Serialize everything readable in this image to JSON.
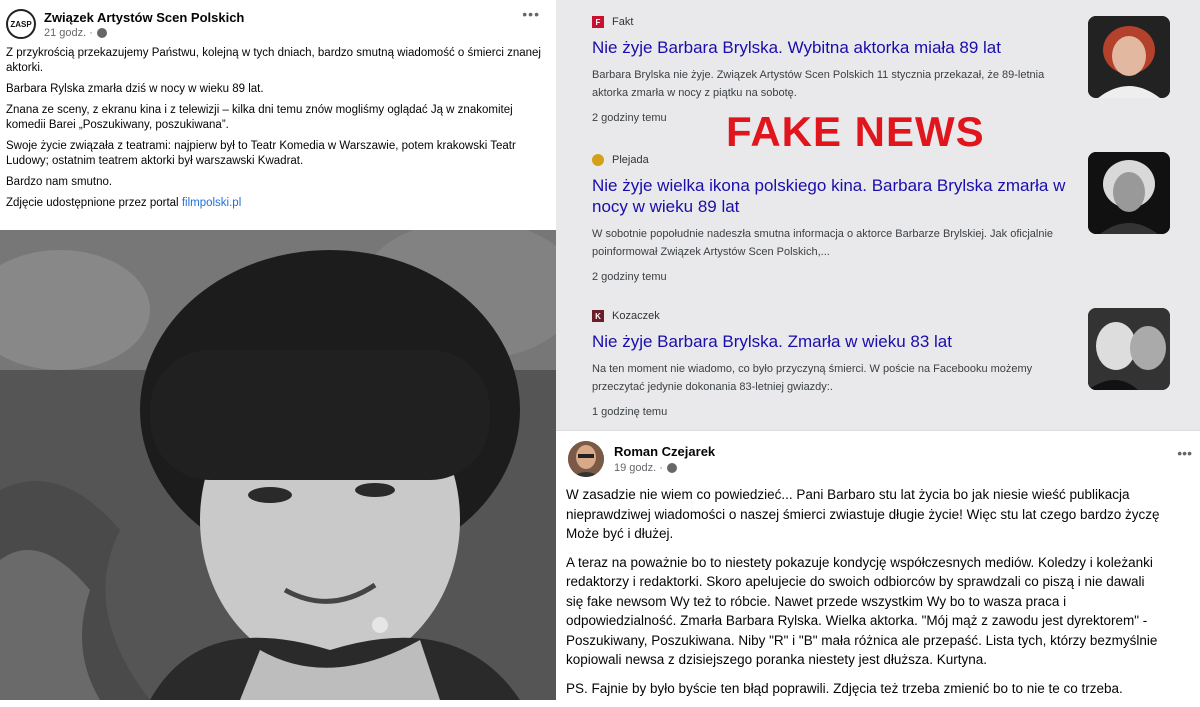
{
  "left_post": {
    "org_logo": "ZASP",
    "author": "Związek Artystów Scen Polskich",
    "time": "21 godz. ·",
    "paragraphs": [
      "Z przykrością przekazujemy Państwu, kolejną w tych dniach, bardzo smutną wiadomość o śmierci znanej aktorki.",
      "Barbara Rylska zmarła dziś w nocy w wieku 89 lat.",
      "Znana ze sceny, z ekranu kina i z telewizji – kilka dni temu znów mogliśmy oglądać Ją w znakomitej komedii Barei „Poszukiwany, poszukiwana”.",
      "Swoje życie związała z teatrami: najpierw był to Teatr Komedia w Warszawie, potem krakowski Teatr Ludowy; ostatnim teatrem aktorki był warszawski Kwadrat.",
      "Bardzo nam smutno."
    ],
    "photo_credit_prefix": "Zdjęcie udostępnione przez portal ",
    "photo_credit_link": "filmpolski.pl"
  },
  "news": {
    "overlay": "FAKE NEWS",
    "items": [
      {
        "source": "Fakt",
        "icon_letter": "F",
        "icon_color": "#c8102e",
        "title": "Nie żyje Barbara Brylska. Wybitna aktorka miała 89 lat",
        "snippet": "Barbara Brylska nie żyje. Związek Artystów Scen Polskich 11 stycznia przekazał, że 89-letnia aktorka zmarła w nocy z piątku na sobotę.",
        "time": "2 godziny temu"
      },
      {
        "source": "Plejada",
        "icon_letter": "",
        "icon_color": "#d4a017",
        "title": "Nie żyje wielka ikona polskiego kina. Barbara Brylska zmarła w nocy w wieku 89 lat",
        "snippet": "W sobotnie popołudnie nadeszła smutna informacja o aktorce Barbarze Brylskiej. Jak oficjalnie poinformował Związek Artystów Scen Polskich,...",
        "time": "2 godziny temu"
      },
      {
        "source": "Kozaczek",
        "icon_letter": "K",
        "icon_color": "#6b1d2a",
        "title": "Nie żyje Barbara Brylska. Zmarła w wieku 83 lat",
        "snippet": "Na ten moment nie wiadomo, co było przyczyną śmierci. W poście na Facebooku możemy przeczytać jedynie dokonania 83-letniej gwiazdy:.",
        "time": "1 godzinę temu"
      }
    ]
  },
  "right_post": {
    "author": "Roman Czejarek",
    "time": "19 godz. ·",
    "lines": [
      "W zasadzie nie wiem co powiedzieć... Pani Barbaro stu lat życia bo jak niesie wieść publikacja",
      "nieprawdziwej wiadomości o naszej śmierci zwiastuje długie życie! Więc stu lat czego bardzo życzę",
      "Może być i dłużej.",
      "A teraz na poważnie bo to niestety pokazuje kondycję współczesnych mediów. Koledzy i koleżanki",
      "redaktorzy i redaktorki. Skoro apelujecie do swoich odbiorców by sprawdzali co piszą i nie dawali",
      "się fake newsom Wy też to róbcie. Nawet przede wszystkim Wy bo to wasza praca i",
      "odpowiedzialność. Zmarła Barbara Rylska. Wielka aktorka. \"Mój mąż z zawodu jest dyrektorem\" -",
      "Poszukiwany, Poszukiwana. Niby \"R\" i \"B\" mała różnica ale przepaść. Lista tych, którzy bezmyślnie",
      "kopiowali newsa z dzisiejszego poranka niestety jest dłuższa. Kurtyna.",
      "PS. Fajnie by było byście ten błąd poprawili. Zdjęcia też trzeba zmienić bo to nie te co trzeba."
    ]
  }
}
